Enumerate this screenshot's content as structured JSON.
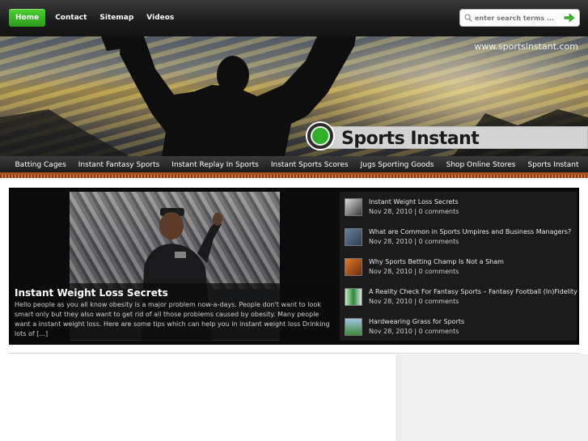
{
  "topnav": {
    "items": [
      {
        "label": "Home",
        "active": true
      },
      {
        "label": "Contact"
      },
      {
        "label": "Sitemap"
      },
      {
        "label": "Videos"
      }
    ]
  },
  "search": {
    "placeholder": "enter search terms ..."
  },
  "header": {
    "url": "www.sportsinstant.com",
    "site_title": "Sports Instant"
  },
  "catnav": {
    "items": [
      {
        "label": "Batting Cages"
      },
      {
        "label": "Instant Fantasy Sports"
      },
      {
        "label": "Instant Replay In Sports"
      },
      {
        "label": "Instant Sports Scores"
      },
      {
        "label": "Jugs Sporting Goods"
      },
      {
        "label": "Shop Online Stores"
      },
      {
        "label": "Sports Instant"
      }
    ]
  },
  "featured": {
    "title": "Instant Weight Loss Secrets",
    "excerpt": "Hello people as you all know obesity is a major problem now-a-days. People don't want to look smart only but they also want to get rid of all those problems caused by obesity. Many people want a instant weight loss. Here are some tips which can help you in instant weight loss Drinking lots of [...]"
  },
  "posts": [
    {
      "title": "Instant Weight Loss Secrets",
      "meta": "Nov 28, 2010 | 0 comments"
    },
    {
      "title": "What are Common in Sports Umpires and Business Managers?",
      "meta": "Nov 28, 2010 | 0 comments"
    },
    {
      "title": "Why Sports Betting Champ Is Not a Sham",
      "meta": "Nov 28, 2010 | 0 comments"
    },
    {
      "title": "A Reality Check For Fantasy Sports – Fantasy Football (In)Fidelity",
      "meta": "Nov 28, 2010 | 0 comments"
    },
    {
      "title": "Hardwearing Grass for Sports",
      "meta": "Nov 28, 2010 | 0 comments"
    }
  ],
  "colors": {
    "accent_green": "#3cb82a",
    "nav_underline": "#a7541f"
  }
}
